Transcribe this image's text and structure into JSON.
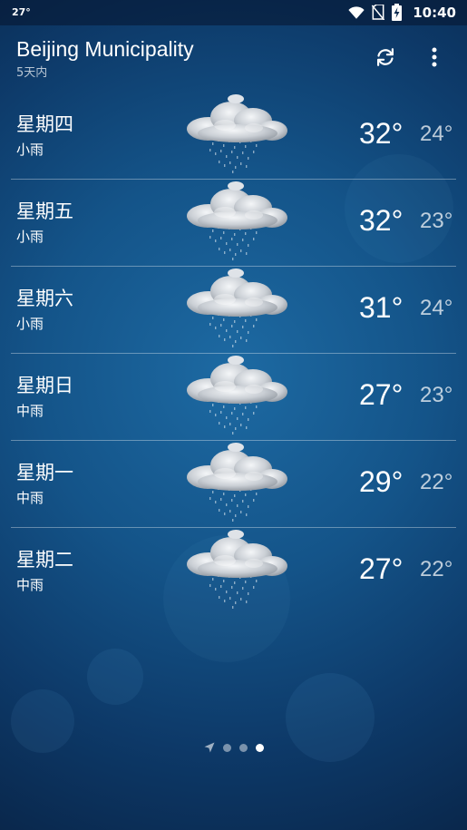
{
  "status_bar": {
    "temperature": "27°",
    "time": "10:40"
  },
  "header": {
    "city": "Beijing Municipality",
    "subtitle": "5天内",
    "refresh_icon": "refresh-icon",
    "menu_icon": "more-vert-icon"
  },
  "forecast": [
    {
      "day": "星期四",
      "condition": "小雨",
      "high": "32°",
      "low": "24°",
      "icon": "rain-cloud-icon"
    },
    {
      "day": "星期五",
      "condition": "小雨",
      "high": "32°",
      "low": "23°",
      "icon": "rain-cloud-icon"
    },
    {
      "day": "星期六",
      "condition": "小雨",
      "high": "31°",
      "low": "24°",
      "icon": "rain-cloud-icon"
    },
    {
      "day": "星期日",
      "condition": "中雨",
      "high": "27°",
      "low": "23°",
      "icon": "rain-cloud-icon"
    },
    {
      "day": "星期一",
      "condition": "中雨",
      "high": "29°",
      "low": "22°",
      "icon": "rain-cloud-icon"
    },
    {
      "day": "星期二",
      "condition": "中雨",
      "high": "27°",
      "low": "22°",
      "icon": "rain-cloud-icon"
    }
  ],
  "page_indicator": {
    "pages": [
      "location-arrow-icon",
      "dot",
      "dot",
      "dot"
    ],
    "active_index": 3
  }
}
